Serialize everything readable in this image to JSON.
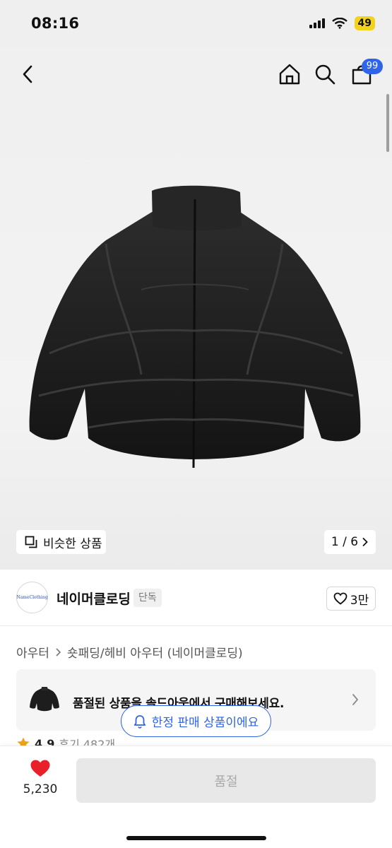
{
  "status": {
    "time": "08:16",
    "battery": "49"
  },
  "header": {
    "cart_count": "99"
  },
  "gallery": {
    "similar_label": "비슷한 상품",
    "page_indicator": "1 / 6"
  },
  "brand": {
    "logo_text": "NameClothing",
    "name": "네이머클로딩",
    "tag": "단독",
    "likes": "3만"
  },
  "breadcrumb": [
    "아우터",
    "숏패딩/헤비 아우터 (네이머클로딩)"
  ],
  "soldout_banner": {
    "text": "품절된 상품을 솔드아웃에서 구매해보세요."
  },
  "limited_badge": "한정 판매 상품이에요",
  "rating": {
    "value": "4.9",
    "reviews": "후기 482개"
  },
  "bottom_bar": {
    "wish_count": "5,230",
    "buy_label": "품절"
  },
  "colors": {
    "accent": "#2f63e8",
    "heart": "#e8202a",
    "star": "#f0a21a",
    "disabled_bg": "#e8e8e8"
  }
}
